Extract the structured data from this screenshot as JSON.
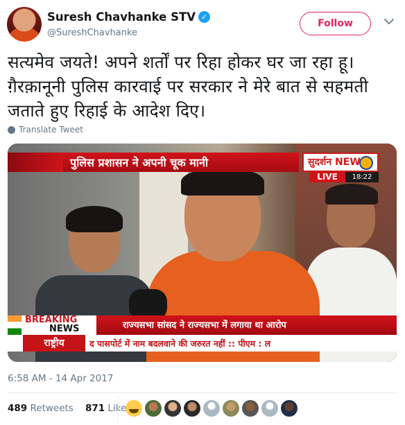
{
  "user": {
    "name": "Suresh Chavhanke STV",
    "handle": "@SureshChavhanke",
    "verified_icon": "verified-badge-icon"
  },
  "actions": {
    "follow_label": "Follow",
    "menu_icon": "chevron-down-icon"
  },
  "tweet": {
    "text": "सत्यमेव जयते! अपने शर्तों पर रिहा होकर घर जा रहा हू। ग़ैरक़ानूनी पुलिस कारवाई पर सरकार ने मेरे बात से सहमती जताते हुए रिहाई के आदेश दिए।",
    "translate_label": "Translate Tweet",
    "timestamp": "6:58 AM - 14 Apr 2017"
  },
  "media": {
    "top_banner": "पुलिस प्रशासन ने अपनी चूक मानी",
    "channel_logo": "सुदर्शन NEWS",
    "live_label": "LIVE",
    "clock": "18:22",
    "breaking_label": "BREAKING",
    "news_label": "NEWS",
    "mid_banner": "राज्यसभा सांसद ने राज्यसभा में लगाया था आरोप",
    "section_label": "राष्ट्रीय",
    "ticker": "द पासपोर्ट में नाम बदलवाने की जरुरत नहीं :: पीएम : ल"
  },
  "stats": {
    "retweets_count": "489",
    "retweets_label": "Retweets",
    "likes_count": "871",
    "likes_label": "Likes"
  },
  "colors": {
    "follow_accent": "#e0245e",
    "verified_blue": "#1da1f2",
    "meta_gray": "#657786"
  }
}
